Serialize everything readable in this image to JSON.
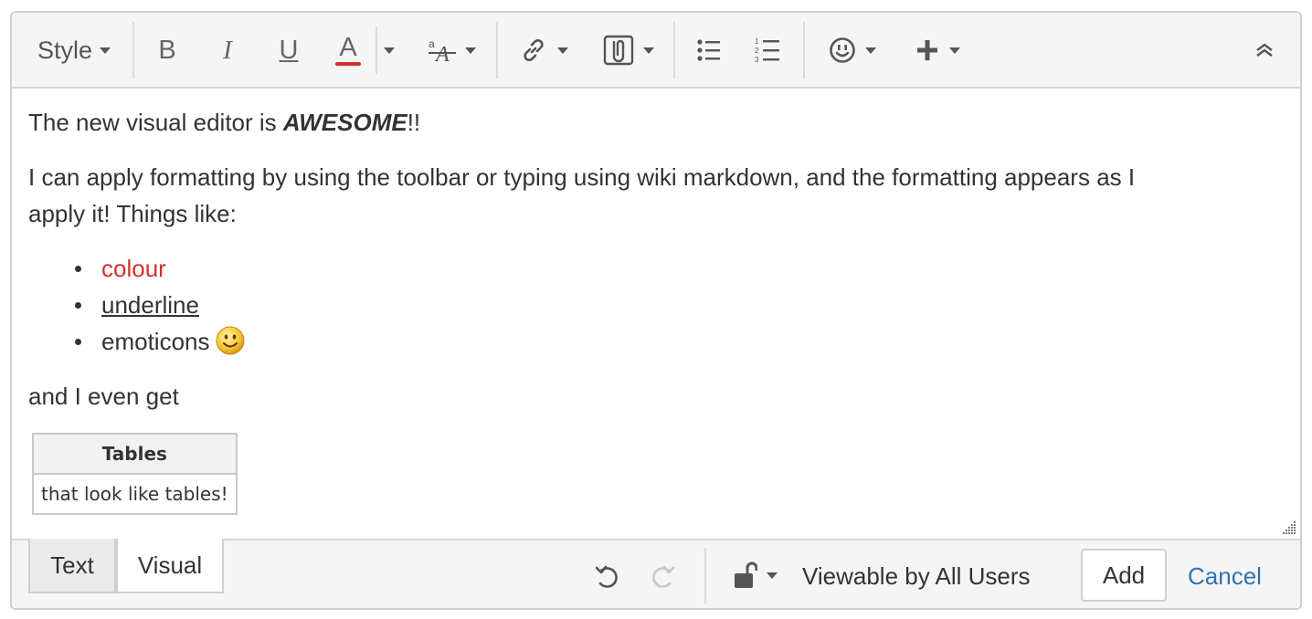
{
  "toolbar": {
    "style_label": "Style",
    "bold_label": "B",
    "italic_label": "I",
    "underline_label": "U",
    "text_color_label": "A",
    "text_color_accent": "#d0312d"
  },
  "content": {
    "line1_prefix": "The new visual editor is ",
    "line1_bold": "AWESOME",
    "line1_suffix": "!!",
    "paragraph2_line1": "I can apply formatting by using the toolbar or typing using wiki markdown, and the formatting appears as I",
    "paragraph2_line2": "apply it! Things like:",
    "list_items": [
      "colour",
      "underline",
      "emoticons"
    ],
    "line3": "and I even get",
    "table": {
      "header": "Tables",
      "cell": "that look like tables!"
    }
  },
  "footer": {
    "tab_text": "Text",
    "tab_visual": "Visual",
    "visibility_label": "Viewable by All Users",
    "add_label": "Add",
    "cancel_label": "Cancel",
    "link_color": "#3572b0"
  }
}
